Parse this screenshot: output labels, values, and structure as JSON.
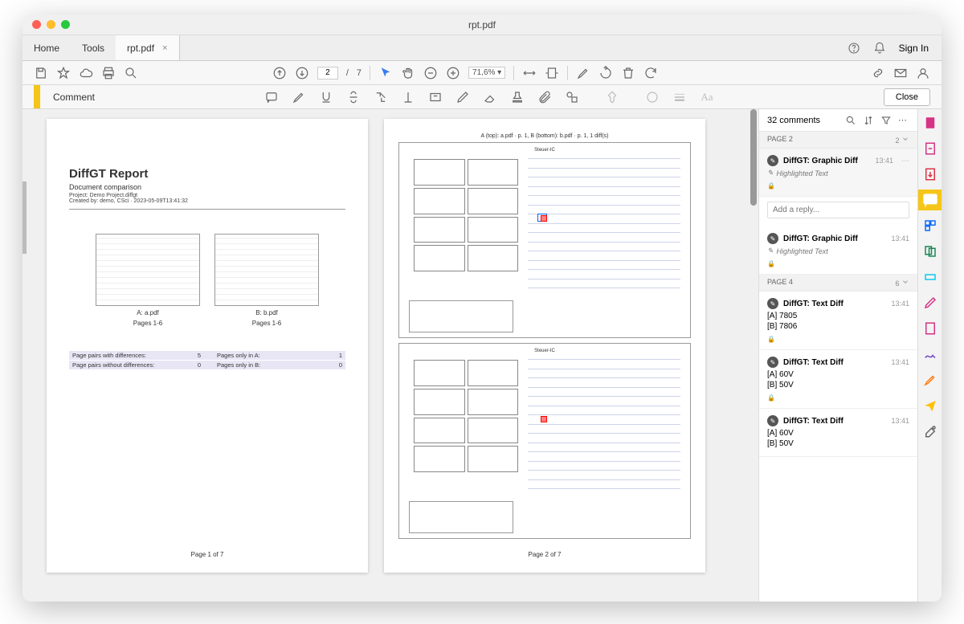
{
  "window": {
    "title": "rpt.pdf"
  },
  "tabs": {
    "home": "Home",
    "tools": "Tools",
    "file": "rpt.pdf"
  },
  "auth": {
    "signin": "Sign In"
  },
  "toolbar": {
    "page_current": "2",
    "page_sep": "/",
    "page_total": "7",
    "zoom": "71,6%"
  },
  "commentbar": {
    "label": "Comment",
    "close": "Close"
  },
  "doc": {
    "page1": {
      "title": "DiffGT Report",
      "subtitle": "Document comparison",
      "project": "Project: Demo Project.diffgt",
      "created": "Created by: demo, CSci · 2023-05-09T13:41:32",
      "thumbA_cap1": "A: a.pdf",
      "thumbA_cap2": "Pages 1-6",
      "thumbB_cap1": "B: b.pdf",
      "thumbB_cap2": "Pages 1-6",
      "stat1a": "Page pairs with differences:",
      "stat1b": "5",
      "stat1c": "Pages only in A:",
      "stat1d": "1",
      "stat2a": "Page pairs without differences:",
      "stat2b": "0",
      "stat2c": "Pages only in B:",
      "stat2d": "0",
      "footer": "Page 1 of 7"
    },
    "page2": {
      "caption": "A (top): a.pdf · p. 1, B (bottom): b.pdf · p. 1, 1 diff(s)",
      "schematic_title": "Steuer-IC",
      "footer": "Page 2 of 7"
    }
  },
  "comments": {
    "header": "32 comments",
    "groups": [
      {
        "label": "PAGE 2",
        "count": "2"
      },
      {
        "label": "PAGE 4",
        "count": "6"
      }
    ],
    "items": [
      {
        "author": "DiffGT: Graphic Diff",
        "time": "13:41",
        "hl": "Highlighted Text"
      },
      {
        "author": "DiffGT: Graphic Diff",
        "time": "13:41",
        "hl": "Highlighted Text"
      },
      {
        "author": "DiffGT: Text Diff",
        "time": "13:41",
        "a": "[A] 7805",
        "b": "[B] 7806"
      },
      {
        "author": "DiffGT: Text Diff",
        "time": "13:41",
        "a": "[A] 60V",
        "b": "[B] 50V"
      },
      {
        "author": "DiffGT: Text Diff",
        "time": "13:41",
        "a": "[A] 60V",
        "b": "[B] 50V"
      }
    ],
    "reply_placeholder": "Add a reply..."
  }
}
